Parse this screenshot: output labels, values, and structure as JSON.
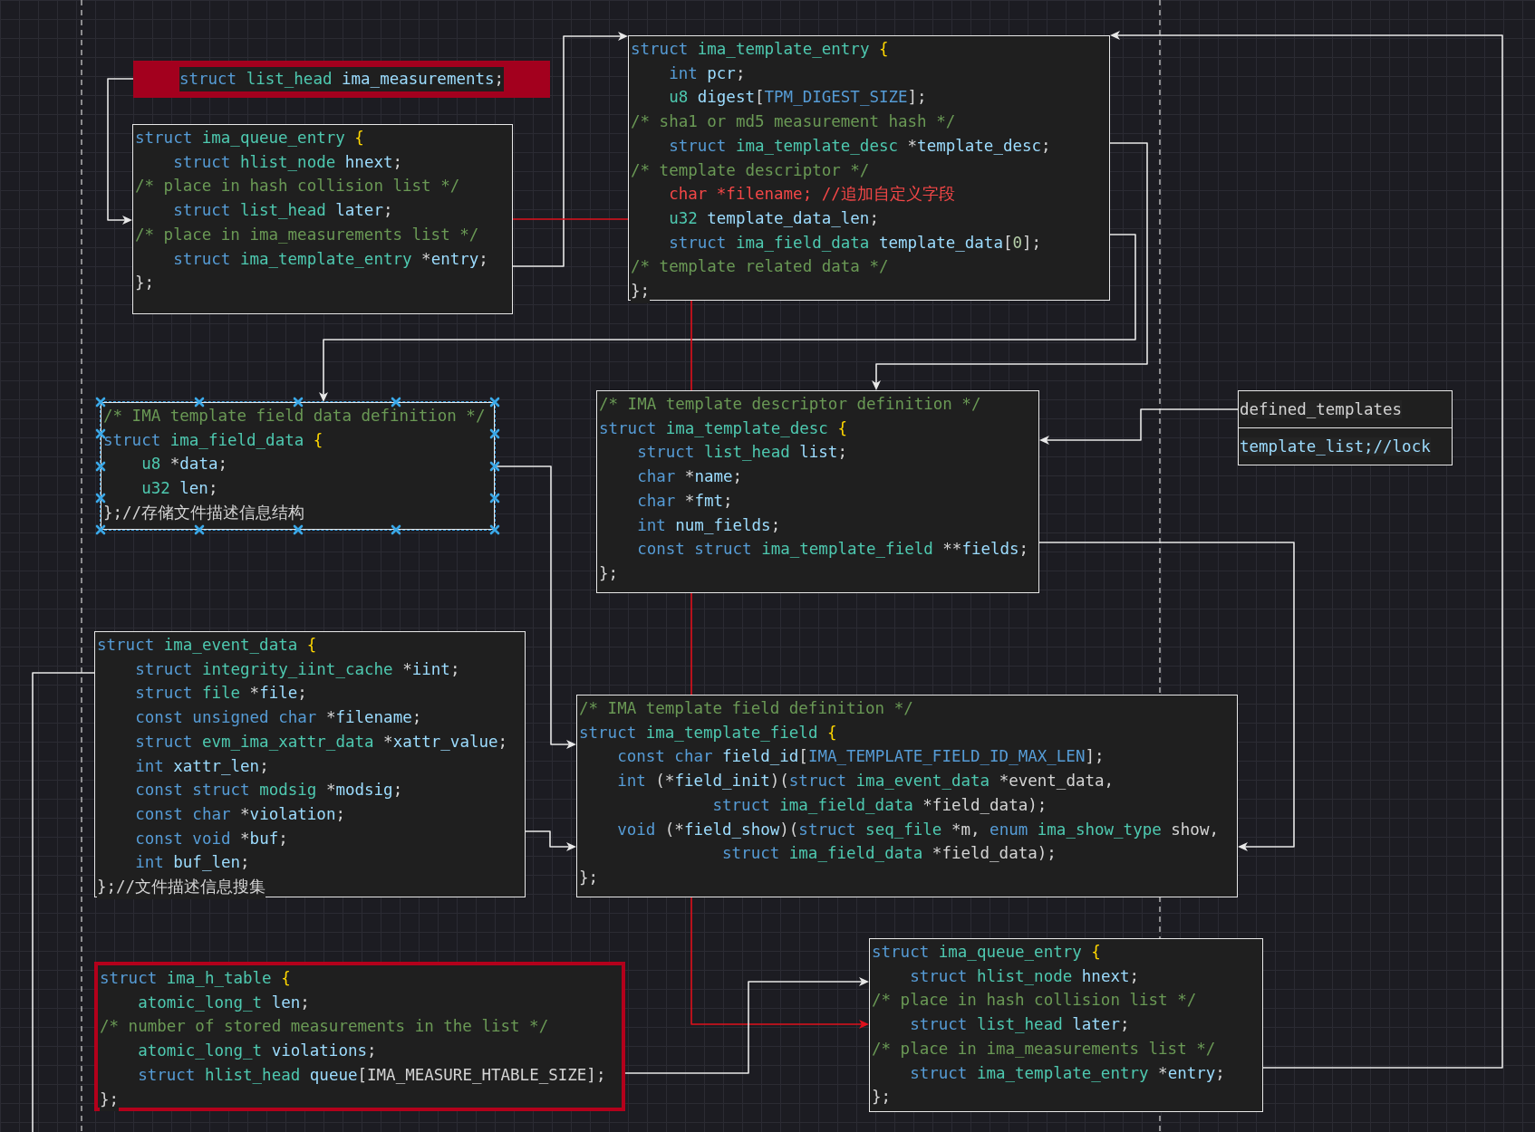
{
  "blocks": [
    {
      "kind": "banner",
      "color": "#a3001e",
      "selected": false,
      "lines": [
        [
          {
            "text": "struct ",
            "kind": "keyword"
          },
          {
            "text": "list_head ",
            "kind": "type"
          },
          {
            "text": "ima_measurements",
            "kind": "name"
          },
          {
            "text": ";",
            "kind": "punct"
          }
        ]
      ]
    },
    {
      "kind": "code",
      "selected": false,
      "lines": [
        [
          {
            "text": "struct ",
            "kind": "keyword"
          },
          {
            "text": "ima_queue_entry ",
            "kind": "type"
          },
          {
            "text": "{",
            "kind": "brace"
          }
        ],
        [
          {
            "text": "    struct ",
            "kind": "keyword"
          },
          {
            "text": "hlist_node ",
            "kind": "type"
          },
          {
            "text": "hnext",
            "kind": "name"
          },
          {
            "text": ";",
            "kind": "punct"
          }
        ],
        [
          {
            "text": "/* place in hash collision list */",
            "kind": "comment"
          }
        ],
        [
          {
            "text": "    struct ",
            "kind": "keyword"
          },
          {
            "text": "list_head ",
            "kind": "type"
          },
          {
            "text": "later",
            "kind": "name"
          },
          {
            "text": ";",
            "kind": "punct"
          }
        ],
        [
          {
            "text": "/* place in ima_measurements list */",
            "kind": "comment"
          }
        ],
        [
          {
            "text": "    struct ",
            "kind": "keyword"
          },
          {
            "text": "ima_template_entry ",
            "kind": "type"
          },
          {
            "text": "*",
            "kind": "punct"
          },
          {
            "text": "entry",
            "kind": "name"
          },
          {
            "text": ";",
            "kind": "punct"
          }
        ],
        [
          {
            "text": "};",
            "kind": "punct"
          }
        ]
      ]
    },
    {
      "kind": "code",
      "selected": false,
      "lines": [
        [
          {
            "text": "struct ",
            "kind": "keyword"
          },
          {
            "text": "ima_template_entry ",
            "kind": "type"
          },
          {
            "text": "{",
            "kind": "brace"
          }
        ],
        [
          {
            "text": "    int ",
            "kind": "keyword"
          },
          {
            "text": "pcr",
            "kind": "name"
          },
          {
            "text": ";",
            "kind": "punct"
          }
        ],
        [
          {
            "text": "    u8 ",
            "kind": "type"
          },
          {
            "text": "digest",
            "kind": "name"
          },
          {
            "text": "[",
            "kind": "punct"
          },
          {
            "text": "TPM_DIGEST_SIZE",
            "kind": "macro"
          },
          {
            "text": "];",
            "kind": "punct"
          }
        ],
        [
          {
            "text": "/* sha1 or md5 measurement hash */",
            "kind": "comment"
          }
        ],
        [
          {
            "text": "    struct ",
            "kind": "keyword"
          },
          {
            "text": "ima_template_desc ",
            "kind": "type"
          },
          {
            "text": "*",
            "kind": "punct"
          },
          {
            "text": "template_desc",
            "kind": "name"
          },
          {
            "text": ";",
            "kind": "punct"
          }
        ],
        [
          {
            "text": "/* template descriptor */",
            "kind": "comment"
          }
        ],
        [
          {
            "text": "    char *filename; //追加自定义字段",
            "kind": "alert"
          }
        ],
        [
          {
            "text": "    u32 ",
            "kind": "type"
          },
          {
            "text": "template_data_len",
            "kind": "name"
          },
          {
            "text": ";",
            "kind": "punct"
          }
        ],
        [
          {
            "text": "    struct ",
            "kind": "keyword"
          },
          {
            "text": "ima_field_data ",
            "kind": "type"
          },
          {
            "text": "template_data",
            "kind": "name"
          },
          {
            "text": "[",
            "kind": "punct"
          },
          {
            "text": "0",
            "kind": "number"
          },
          {
            "text": "];",
            "kind": "punct"
          }
        ],
        [
          {
            "text": "/* template related data */",
            "kind": "comment"
          }
        ],
        [
          {
            "text": "};",
            "kind": "punct"
          }
        ]
      ]
    },
    {
      "kind": "code",
      "selected": true,
      "lines": [
        [
          {
            "text": "/* IMA template field data definition */",
            "kind": "comment"
          }
        ],
        [
          {
            "text": "struct ",
            "kind": "keyword"
          },
          {
            "text": "ima_field_data ",
            "kind": "type"
          },
          {
            "text": "{",
            "kind": "brace"
          }
        ],
        [
          {
            "text": "    u8 ",
            "kind": "type"
          },
          {
            "text": "*",
            "kind": "punct"
          },
          {
            "text": "data",
            "kind": "name"
          },
          {
            "text": ";",
            "kind": "punct"
          }
        ],
        [
          {
            "text": "    u32 ",
            "kind": "type"
          },
          {
            "text": "len",
            "kind": "name"
          },
          {
            "text": ";",
            "kind": "punct"
          }
        ],
        [
          {
            "text": "};//存储文件描述信息结构",
            "kind": "punct"
          }
        ]
      ]
    },
    {
      "kind": "code",
      "selected": false,
      "lines": [
        [
          {
            "text": "/* IMA template descriptor definition */",
            "kind": "comment"
          }
        ],
        [
          {
            "text": "struct ",
            "kind": "keyword"
          },
          {
            "text": "ima_template_desc ",
            "kind": "type"
          },
          {
            "text": "{",
            "kind": "brace"
          }
        ],
        [
          {
            "text": "    struct ",
            "kind": "keyword"
          },
          {
            "text": "list_head ",
            "kind": "type"
          },
          {
            "text": "list",
            "kind": "name"
          },
          {
            "text": ";",
            "kind": "punct"
          }
        ],
        [
          {
            "text": "    char ",
            "kind": "keyword"
          },
          {
            "text": "*",
            "kind": "punct"
          },
          {
            "text": "name",
            "kind": "name"
          },
          {
            "text": ";",
            "kind": "punct"
          }
        ],
        [
          {
            "text": "    char ",
            "kind": "keyword"
          },
          {
            "text": "*",
            "kind": "punct"
          },
          {
            "text": "fmt",
            "kind": "name"
          },
          {
            "text": ";",
            "kind": "punct"
          }
        ],
        [
          {
            "text": "    int ",
            "kind": "keyword"
          },
          {
            "text": "num_fields",
            "kind": "name"
          },
          {
            "text": ";",
            "kind": "punct"
          }
        ],
        [
          {
            "text": "    const struct ",
            "kind": "keyword"
          },
          {
            "text": "ima_template_field ",
            "kind": "type"
          },
          {
            "text": "**",
            "kind": "punct"
          },
          {
            "text": "fields",
            "kind": "name"
          },
          {
            "text": ";",
            "kind": "punct"
          }
        ],
        [
          {
            "text": "};",
            "kind": "punct"
          }
        ]
      ]
    },
    {
      "kind": "list",
      "selected": false,
      "rows": [
        {
          "text": "defined_templates",
          "kind": "punct"
        },
        {
          "text": "template_list;//lock",
          "kind": "name"
        }
      ]
    },
    {
      "kind": "code",
      "selected": false,
      "lines": [
        [
          {
            "text": "struct ",
            "kind": "keyword"
          },
          {
            "text": "ima_event_data ",
            "kind": "type"
          },
          {
            "text": "{",
            "kind": "brace"
          }
        ],
        [
          {
            "text": "    struct ",
            "kind": "keyword"
          },
          {
            "text": "integrity_iint_cache ",
            "kind": "type"
          },
          {
            "text": "*",
            "kind": "punct"
          },
          {
            "text": "iint",
            "kind": "name"
          },
          {
            "text": ";",
            "kind": "punct"
          }
        ],
        [
          {
            "text": "    struct ",
            "kind": "keyword"
          },
          {
            "text": "file ",
            "kind": "type"
          },
          {
            "text": "*",
            "kind": "punct"
          },
          {
            "text": "file",
            "kind": "name"
          },
          {
            "text": ";",
            "kind": "punct"
          }
        ],
        [
          {
            "text": "    const unsigned char ",
            "kind": "keyword"
          },
          {
            "text": "*",
            "kind": "punct"
          },
          {
            "text": "filename",
            "kind": "name"
          },
          {
            "text": ";",
            "kind": "punct"
          }
        ],
        [
          {
            "text": "    struct ",
            "kind": "keyword"
          },
          {
            "text": "evm_ima_xattr_data ",
            "kind": "type"
          },
          {
            "text": "*",
            "kind": "punct"
          },
          {
            "text": "xattr_value",
            "kind": "name"
          },
          {
            "text": ";",
            "kind": "punct"
          }
        ],
        [
          {
            "text": "    int ",
            "kind": "keyword"
          },
          {
            "text": "xattr_len",
            "kind": "name"
          },
          {
            "text": ";",
            "kind": "punct"
          }
        ],
        [
          {
            "text": "    const struct ",
            "kind": "keyword"
          },
          {
            "text": "modsig ",
            "kind": "type"
          },
          {
            "text": "*",
            "kind": "punct"
          },
          {
            "text": "modsig",
            "kind": "name"
          },
          {
            "text": ";",
            "kind": "punct"
          }
        ],
        [
          {
            "text": "    const char ",
            "kind": "keyword"
          },
          {
            "text": "*",
            "kind": "punct"
          },
          {
            "text": "violation",
            "kind": "name"
          },
          {
            "text": ";",
            "kind": "punct"
          }
        ],
        [
          {
            "text": "    const void ",
            "kind": "keyword"
          },
          {
            "text": "*",
            "kind": "punct"
          },
          {
            "text": "buf",
            "kind": "name"
          },
          {
            "text": ";",
            "kind": "punct"
          }
        ],
        [
          {
            "text": "    int ",
            "kind": "keyword"
          },
          {
            "text": "buf_len",
            "kind": "name"
          },
          {
            "text": ";",
            "kind": "punct"
          }
        ],
        [
          {
            "text": "};//文件描述信息搜集",
            "kind": "punct"
          }
        ]
      ]
    },
    {
      "kind": "code",
      "selected": false,
      "lines": [
        [
          {
            "text": "/* IMA template field definition */",
            "kind": "comment"
          }
        ],
        [
          {
            "text": "struct ",
            "kind": "keyword"
          },
          {
            "text": "ima_template_field ",
            "kind": "type"
          },
          {
            "text": "{",
            "kind": "brace"
          }
        ],
        [
          {
            "text": "    const char ",
            "kind": "keyword"
          },
          {
            "text": "field_id",
            "kind": "name"
          },
          {
            "text": "[",
            "kind": "punct"
          },
          {
            "text": "IMA_TEMPLATE_FIELD_ID_MAX_LEN",
            "kind": "macro"
          },
          {
            "text": "];",
            "kind": "punct"
          }
        ],
        [
          {
            "text": "    int ",
            "kind": "keyword"
          },
          {
            "text": "(*",
            "kind": "punct"
          },
          {
            "text": "field_init",
            "kind": "name"
          },
          {
            "text": ")(",
            "kind": "punct"
          },
          {
            "text": "struct ",
            "kind": "keyword"
          },
          {
            "text": "ima_event_data ",
            "kind": "type"
          },
          {
            "text": "*event_data,",
            "kind": "punct"
          }
        ],
        [
          {
            "text": "              struct ",
            "kind": "keyword"
          },
          {
            "text": "ima_field_data ",
            "kind": "type"
          },
          {
            "text": "*field_data);",
            "kind": "punct"
          }
        ],
        [
          {
            "text": "    void ",
            "kind": "keyword"
          },
          {
            "text": "(*",
            "kind": "punct"
          },
          {
            "text": "field_show",
            "kind": "name"
          },
          {
            "text": ")(",
            "kind": "punct"
          },
          {
            "text": "struct ",
            "kind": "keyword"
          },
          {
            "text": "seq_file ",
            "kind": "type"
          },
          {
            "text": "*m, ",
            "kind": "punct"
          },
          {
            "text": "enum ",
            "kind": "keyword"
          },
          {
            "text": "ima_show_type ",
            "kind": "type"
          },
          {
            "text": "show,",
            "kind": "punct"
          }
        ],
        [
          {
            "text": "               struct ",
            "kind": "keyword"
          },
          {
            "text": "ima_field_data ",
            "kind": "type"
          },
          {
            "text": "*field_data);",
            "kind": "punct"
          }
        ],
        [
          {
            "text": "};",
            "kind": "punct"
          }
        ]
      ]
    },
    {
      "kind": "code",
      "color": "#b3001b",
      "selected": false,
      "lines": [
        [
          {
            "text": "struct ",
            "kind": "keyword"
          },
          {
            "text": "ima_h_table ",
            "kind": "type"
          },
          {
            "text": "{",
            "kind": "brace"
          }
        ],
        [
          {
            "text": "    atomic_long_t ",
            "kind": "type"
          },
          {
            "text": "len",
            "kind": "name"
          },
          {
            "text": ";",
            "kind": "punct"
          }
        ],
        [
          {
            "text": "/* number of stored measurements in the list */",
            "kind": "comment"
          }
        ],
        [
          {
            "text": "    atomic_long_t ",
            "kind": "type"
          },
          {
            "text": "violations",
            "kind": "name"
          },
          {
            "text": ";",
            "kind": "punct"
          }
        ],
        [
          {
            "text": "    struct ",
            "kind": "keyword"
          },
          {
            "text": "hlist_head ",
            "kind": "type"
          },
          {
            "text": "queue",
            "kind": "name"
          },
          {
            "text": "[IMA_MEASURE_HTABLE_SIZE];",
            "kind": "punct"
          }
        ],
        [
          {
            "text": "};",
            "kind": "punct"
          }
        ]
      ]
    },
    {
      "kind": "code",
      "selected": false,
      "lines": [
        [
          {
            "text": "struct ",
            "kind": "keyword"
          },
          {
            "text": "ima_queue_entry ",
            "kind": "type"
          },
          {
            "text": "{",
            "kind": "brace"
          }
        ],
        [
          {
            "text": "    struct ",
            "kind": "keyword"
          },
          {
            "text": "hlist_node ",
            "kind": "type"
          },
          {
            "text": "hnext",
            "kind": "name"
          },
          {
            "text": ";",
            "kind": "punct"
          }
        ],
        [
          {
            "text": "/* place in hash collision list */",
            "kind": "comment"
          }
        ],
        [
          {
            "text": "    struct ",
            "kind": "keyword"
          },
          {
            "text": "list_head ",
            "kind": "type"
          },
          {
            "text": "later",
            "kind": "name"
          },
          {
            "text": ";",
            "kind": "punct"
          }
        ],
        [
          {
            "text": "/* place in ima_measurements list */",
            "kind": "comment"
          }
        ],
        [
          {
            "text": "    struct ",
            "kind": "keyword"
          },
          {
            "text": "ima_template_entry ",
            "kind": "type"
          },
          {
            "text": "*",
            "kind": "punct"
          },
          {
            "text": "entry",
            "kind": "name"
          },
          {
            "text": ";",
            "kind": "punct"
          }
        ],
        [
          {
            "text": "};",
            "kind": "punct"
          }
        ]
      ]
    }
  ]
}
